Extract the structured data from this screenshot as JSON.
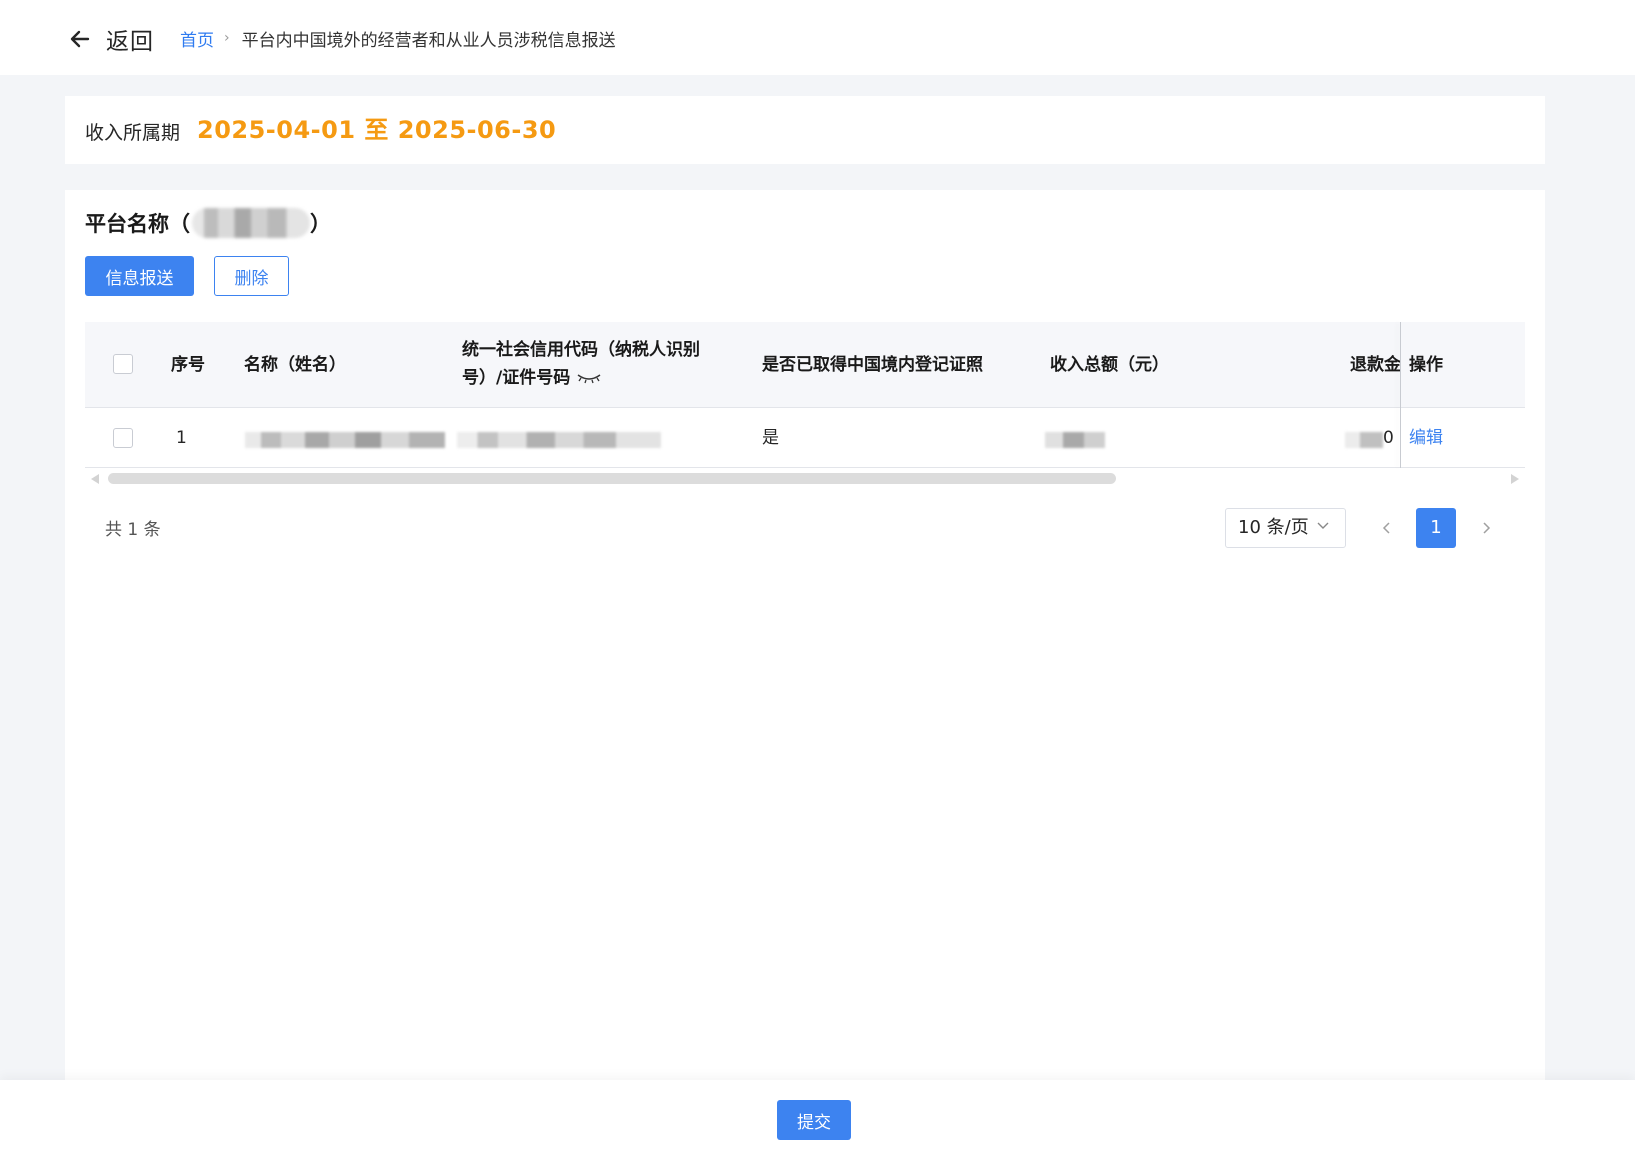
{
  "header": {
    "back_label": "返回",
    "breadcrumb": {
      "home": "首页",
      "separator": "›",
      "current": "平台内中国境外的经营者和从业人员涉税信息报送"
    }
  },
  "period": {
    "label": "收入所属期",
    "range": "2025-04-01 至 2025-06-30"
  },
  "platform": {
    "title_prefix": "平台名称（",
    "title_suffix": "）"
  },
  "actions": {
    "submit_info": "信息报送",
    "delete": "删除"
  },
  "table": {
    "columns": {
      "index": "序号",
      "name": "名称（姓名）",
      "credit_code_line1": "统一社会信用代码（纳税人识别",
      "credit_code_line2": "号）/证件号码",
      "has_license": "是否已取得中国境内登记证照",
      "income_total": "收入总额（元）",
      "refund": "退款金",
      "operation": "操作"
    },
    "rows": [
      {
        "index": "1",
        "has_license": "是",
        "refund_visible_tail": "0",
        "action": "编辑"
      }
    ]
  },
  "pagination": {
    "total": "共 1 条",
    "page_size": "10 条/页",
    "current_page": "1"
  },
  "footer": {
    "submit": "提交"
  },
  "colors": {
    "primary": "#3d83f0",
    "period_highlight": "#f59a12"
  }
}
